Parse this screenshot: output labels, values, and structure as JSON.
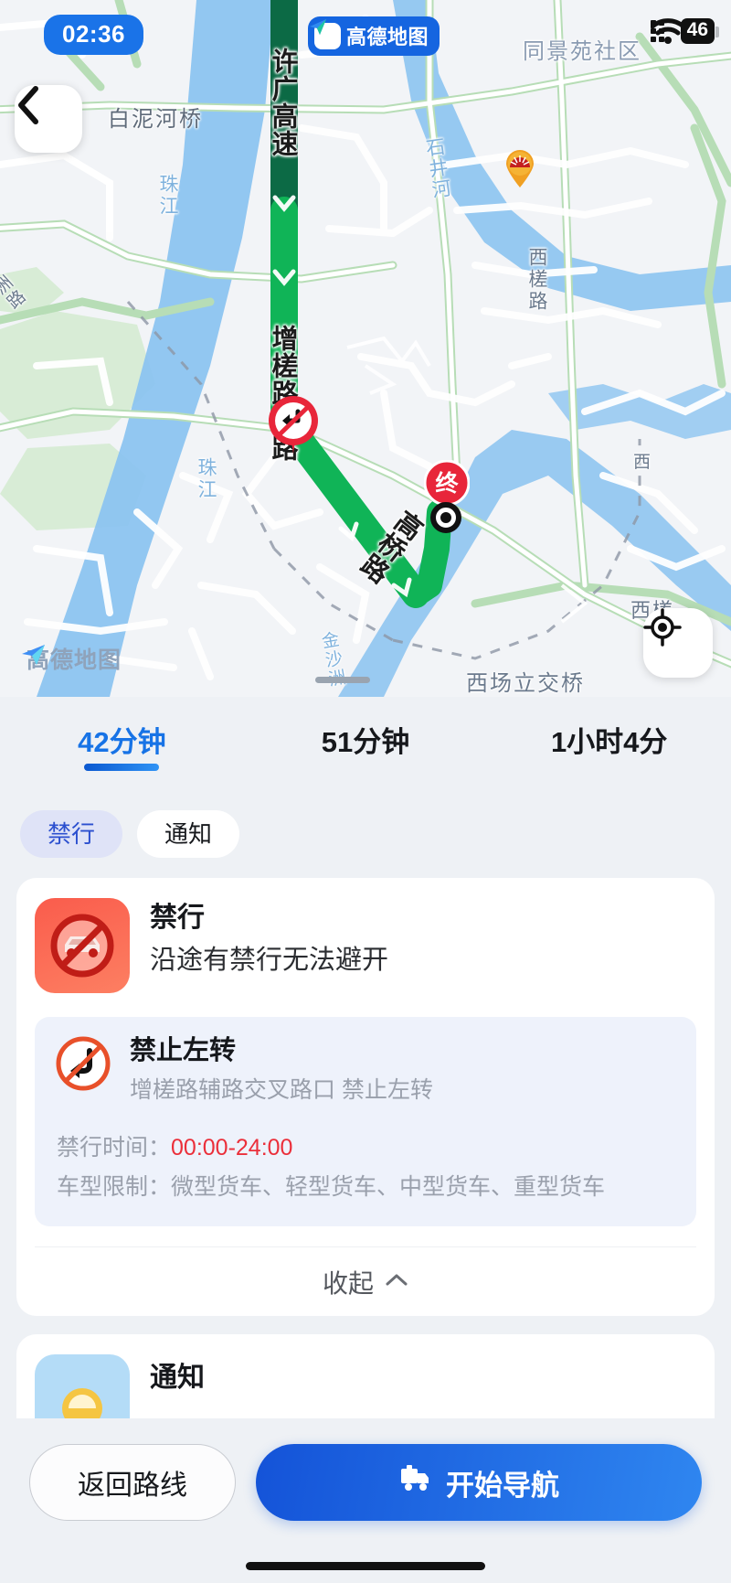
{
  "status_bar": {
    "time": "02:36",
    "battery_level": "46",
    "wifi_icon": "wifi-icon",
    "signal_icon": "signal-dots-icon"
  },
  "map": {
    "app_badge_label": "高德地图",
    "watermark_label": "高德地图",
    "back_icon": "chevron-left-icon",
    "locate_icon": "crosshair-icon",
    "route_labels": [
      {
        "text": "许广高速"
      },
      {
        "text": "增槎路辅路"
      },
      {
        "text": "高桥路"
      }
    ],
    "place_labels": [
      {
        "text": "白泥河桥"
      },
      {
        "text": "珠江"
      },
      {
        "text": "珠江"
      },
      {
        "text": "石井河"
      },
      {
        "text": "西槎路"
      },
      {
        "text": "西场立交桥"
      },
      {
        "text": "同景苑社区"
      },
      {
        "text": "金沙洲"
      },
      {
        "text": "洲路"
      },
      {
        "text": "西"
      }
    ],
    "markers": [
      {
        "name": "no-left-turn-marker",
        "label": ""
      },
      {
        "name": "destination-marker",
        "label": "终"
      },
      {
        "name": "poi-marker",
        "label": ""
      }
    ]
  },
  "route_tabs": [
    {
      "label": "42分钟",
      "active": true
    },
    {
      "label": "51分钟",
      "active": false
    },
    {
      "label": "1小时4分",
      "active": false
    }
  ],
  "filter_chips": [
    {
      "label": "禁行",
      "active": true
    },
    {
      "label": "通知",
      "active": false
    }
  ],
  "restriction_card": {
    "title": "禁行",
    "subtitle": "沿途有禁行无法避开",
    "detail": {
      "title": "禁止左转",
      "location": "增槎路辅路交叉路口 禁止左转",
      "time_label": "禁行时间：",
      "time_value": "00:00-24:00",
      "vehicle_label": "车型限制：",
      "vehicle_value": "微型货车、轻型货车、中型货车、重型货车"
    },
    "collapse_label": "收起",
    "collapse_icon": "chevron-up-icon"
  },
  "notice_card": {
    "title": "通知"
  },
  "bottom_bar": {
    "back_route_label": "返回路线",
    "start_nav_label": "开始导航",
    "start_nav_icon": "truck-icon"
  },
  "colors": {
    "accent_blue": "#1773e6",
    "route_green": "#12b257",
    "route_dark_green": "#11714a",
    "danger_red": "#eb2f3a",
    "chip_active_bg": "#dfe3f7"
  }
}
